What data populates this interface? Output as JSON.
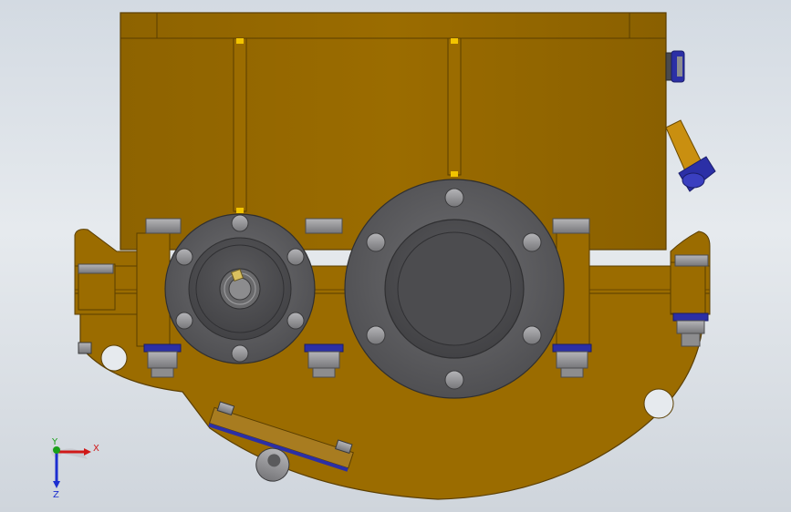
{
  "viewport": {
    "background_top": "#d3dae2",
    "background_bottom": "#cfd5dc"
  },
  "model": {
    "body_color": "#9b6c00",
    "body_edge_color": "#6b4a00",
    "flange_color": "#5e5e60",
    "bolt_color": "#8d8d8f",
    "seal_color": "#2b2fa6",
    "accent_color": "#f2c400"
  },
  "triad": {
    "x_label": "X",
    "y_label": "Y",
    "z_label": "Z",
    "x_color": "#d01818",
    "y_color": "#19a019",
    "z_color": "#1c2ed0"
  }
}
